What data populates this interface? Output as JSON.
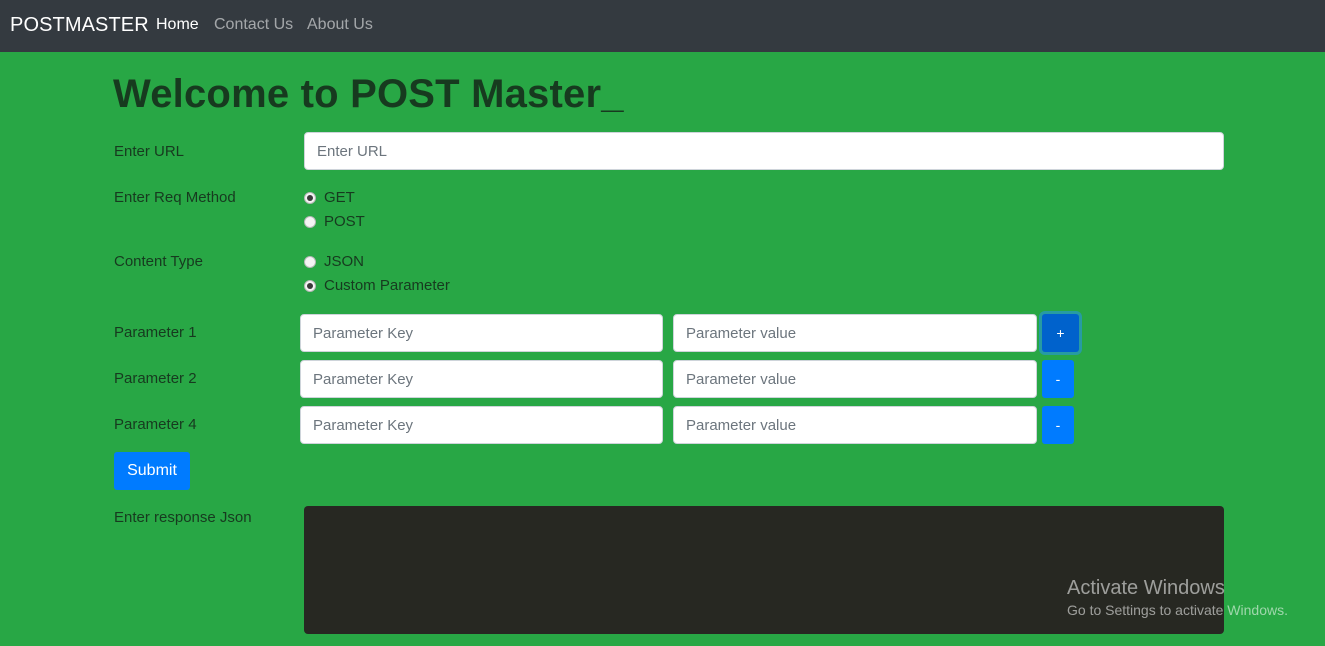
{
  "navbar": {
    "brand": "POSTMASTER",
    "links": [
      {
        "label": "Home",
        "active": true
      },
      {
        "label": "Contact Us",
        "active": false
      },
      {
        "label": "About Us",
        "active": false
      }
    ]
  },
  "main": {
    "title": "Welcome to POST Master_",
    "url": {
      "label": "Enter URL",
      "placeholder": "Enter URL",
      "value": ""
    },
    "req_method": {
      "label": "Enter Req Method",
      "options": [
        {
          "label": "GET",
          "checked": true
        },
        {
          "label": "POST",
          "checked": false
        }
      ]
    },
    "content_type": {
      "label": "Content Type",
      "options": [
        {
          "label": "JSON",
          "checked": false
        },
        {
          "label": "Custom Parameter",
          "checked": true
        }
      ]
    },
    "parameters": [
      {
        "label": "Parameter 1",
        "key_placeholder": "Parameter Key",
        "value_placeholder": "Parameter value",
        "button": "+"
      },
      {
        "label": "Parameter 2",
        "key_placeholder": "Parameter Key",
        "value_placeholder": "Parameter value",
        "button": "-"
      },
      {
        "label": "Parameter 4",
        "key_placeholder": "Parameter Key",
        "value_placeholder": "Parameter value",
        "button": "-"
      }
    ],
    "submit_label": "Submit",
    "response": {
      "label": "Enter response Json",
      "value": ""
    }
  },
  "watermark": {
    "title": "Activate Windows",
    "subtitle": "Go to Settings to activate Windows."
  },
  "colors": {
    "page_background": "#28a745",
    "navbar_background": "#343a40",
    "primary_button": "#007bff",
    "editor_background": "#272822"
  }
}
